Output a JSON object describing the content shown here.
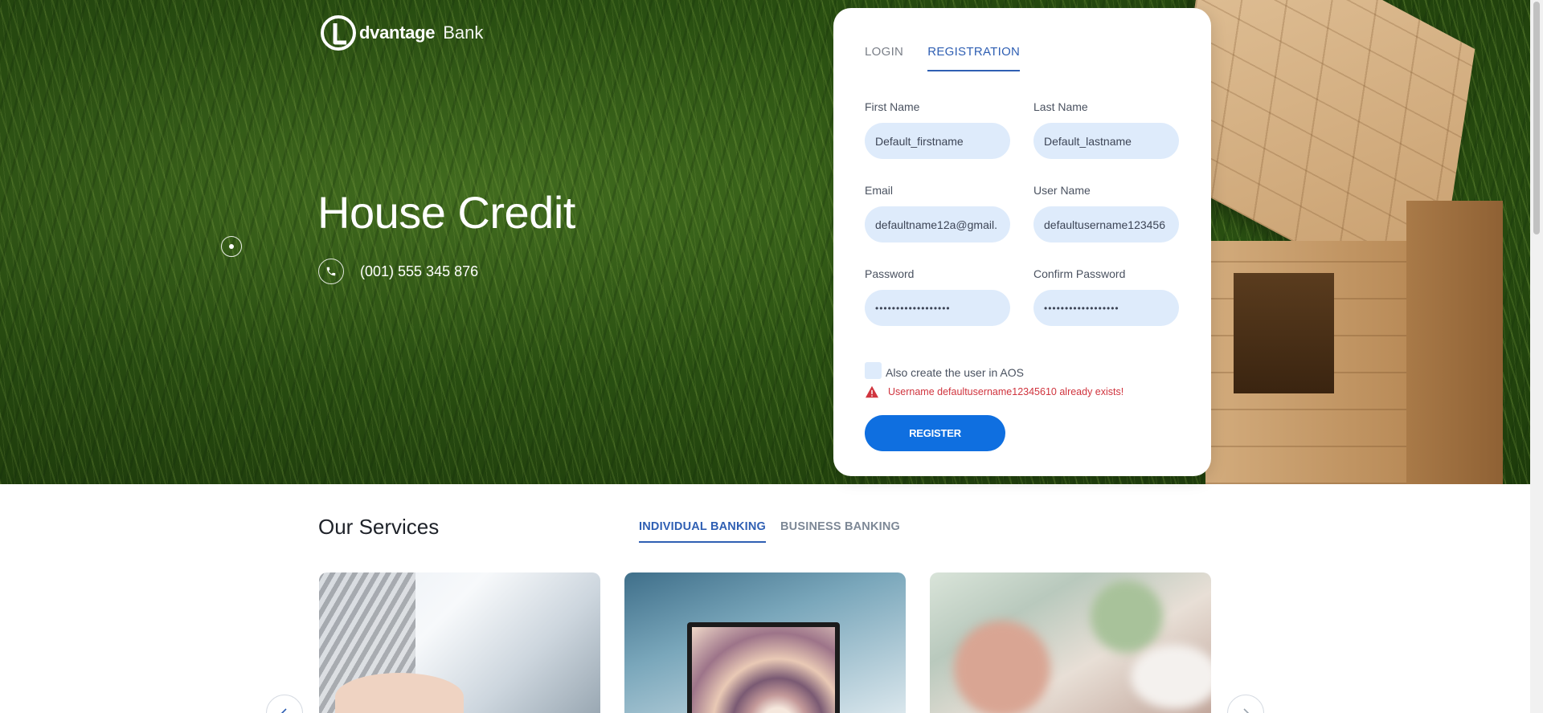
{
  "brand": {
    "logo_text": "dvantage",
    "logo_sub": "Bank"
  },
  "hero": {
    "title": "House Credit",
    "phone": "(001) 555 345 876"
  },
  "auth": {
    "tabs": [
      {
        "label": "LOGIN",
        "active": false
      },
      {
        "label": "REGISTRATION",
        "active": true
      }
    ],
    "fields": {
      "first_name": {
        "label": "First Name",
        "value": "Default_firstname"
      },
      "last_name": {
        "label": "Last Name",
        "value": "Default_lastname"
      },
      "email": {
        "label": "Email",
        "value": "defaultname12a@gmail."
      },
      "username": {
        "label": "User Name",
        "value": "defaultusername123456"
      },
      "password": {
        "label": "Password",
        "value": "••••••••••••••••••"
      },
      "confirm_password": {
        "label": "Confirm Password",
        "value": "••••••••••••••••••"
      }
    },
    "checkbox_label": "Also create the user in AOS",
    "error_message": "Username defaultusername12345610 already exists!",
    "register_label": "REGISTER"
  },
  "services": {
    "title": "Our Services",
    "tabs": [
      {
        "label": "INDIVIDUAL BANKING",
        "active": true
      },
      {
        "label": "BUSINESS BANKING",
        "active": false
      }
    ]
  },
  "colors": {
    "accent": "#2f5fb3",
    "button": "#0f6fe0",
    "input_bg": "#deebfb",
    "error": "#d0343e"
  },
  "icons": [
    "logo-mark-icon",
    "phone-icon",
    "dot-icon",
    "warning-icon",
    "chevron-left-icon",
    "chevron-right-icon"
  ]
}
